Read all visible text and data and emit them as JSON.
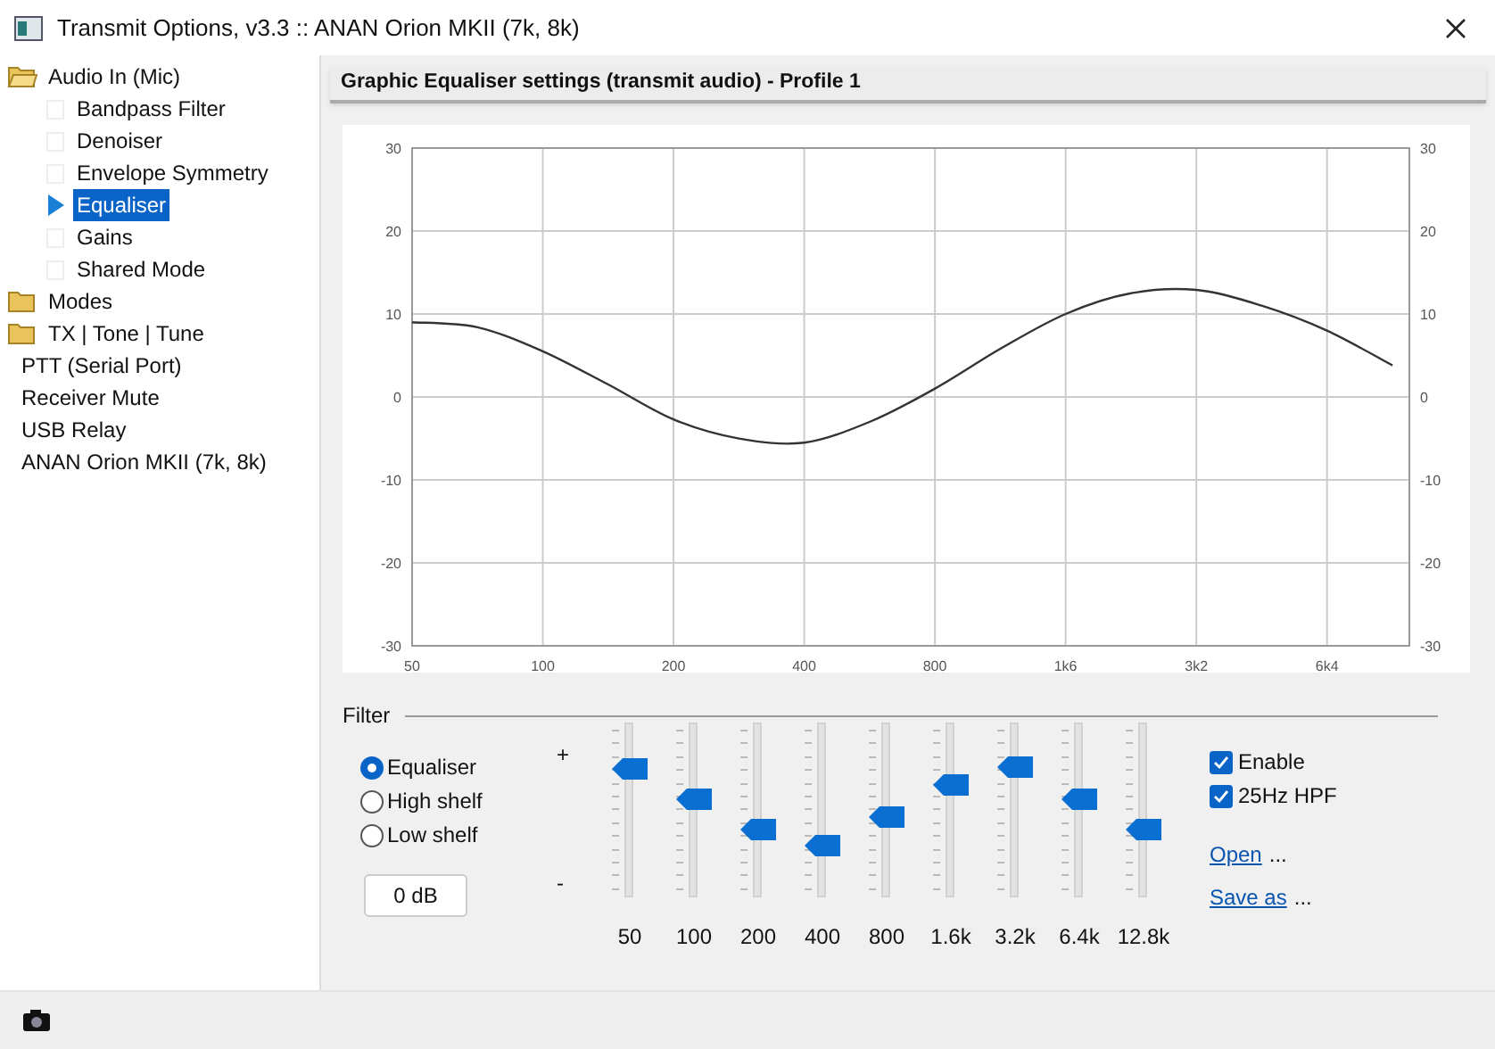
{
  "window": {
    "title": "Transmit Options, v3.3 :: ANAN Orion MKII (7k, 8k)"
  },
  "tree": [
    {
      "label": "Audio In (Mic)",
      "kind": "folder",
      "expanded": true,
      "selected": false,
      "children": [
        {
          "label": "Bandpass Filter",
          "selected": false
        },
        {
          "label": "Denoiser",
          "selected": false
        },
        {
          "label": "Envelope Symmetry",
          "selected": false
        },
        {
          "label": "Equaliser",
          "selected": true
        },
        {
          "label": "Gains",
          "selected": false
        },
        {
          "label": "Shared Mode",
          "selected": false
        }
      ]
    },
    {
      "label": "Modes",
      "kind": "folder",
      "expanded": false,
      "selected": false
    },
    {
      "label": "TX | Tone | Tune",
      "kind": "folder",
      "expanded": false,
      "selected": false
    },
    {
      "label": "PTT (Serial Port)",
      "kind": "page",
      "selected": false
    },
    {
      "label": "Receiver Mute",
      "kind": "page",
      "selected": false
    },
    {
      "label": "USB Relay",
      "kind": "page",
      "selected": false
    },
    {
      "label": "ANAN Orion MKII (7k, 8k)",
      "kind": "page",
      "selected": false
    }
  ],
  "panel": {
    "header": "Graphic Equaliser settings (transmit audio) - Profile 1",
    "chart_data": {
      "type": "line",
      "categories": [
        "50",
        null,
        "100",
        null,
        "200",
        null,
        "400",
        null,
        "800",
        null,
        "1k6",
        null,
        "3k2",
        null,
        "6k4",
        null
      ],
      "series": [
        {
          "color": "#333333",
          "values": [
            9,
            8.4,
            5.5,
            1.5,
            -2.7,
            -5,
            -5.5,
            -3,
            1,
            5.8,
            10,
            12.5,
            12.9,
            11,
            8,
            3.8
          ]
        }
      ],
      "ylim": [
        -30,
        30
      ],
      "grid": true,
      "yticks": [
        30,
        20,
        10,
        0,
        -10,
        -20,
        -30
      ]
    },
    "right_axis_labels": [
      "30",
      "20",
      "10",
      "0",
      "-10",
      "-20",
      "-30"
    ]
  },
  "filter": {
    "title": "Filter",
    "modes": [
      {
        "label": "Equaliser",
        "selected": true
      },
      {
        "label": "High shelf",
        "selected": false
      },
      {
        "label": "Low shelf",
        "selected": false
      }
    ],
    "gain_button": "0 dB",
    "plus": "+",
    "minus": "-",
    "bands": [
      {
        "label": "50",
        "level": 0.8
      },
      {
        "label": "100",
        "level": 0.6
      },
      {
        "label": "200",
        "level": 0.41
      },
      {
        "label": "400",
        "level": 0.31
      },
      {
        "label": "800",
        "level": 0.49
      },
      {
        "label": "1.6k",
        "level": 0.69
      },
      {
        "label": "3.2k",
        "level": 0.81
      },
      {
        "label": "6.4k",
        "level": 0.6
      },
      {
        "label": "12.8k",
        "level": 0.41
      }
    ],
    "options": [
      {
        "label": "Enable",
        "checked": true
      },
      {
        "label": "25Hz HPF",
        "checked": true
      }
    ],
    "links": [
      {
        "label": "Open",
        "suffix": "..."
      },
      {
        "label": "Save as",
        "suffix": "..."
      }
    ]
  }
}
